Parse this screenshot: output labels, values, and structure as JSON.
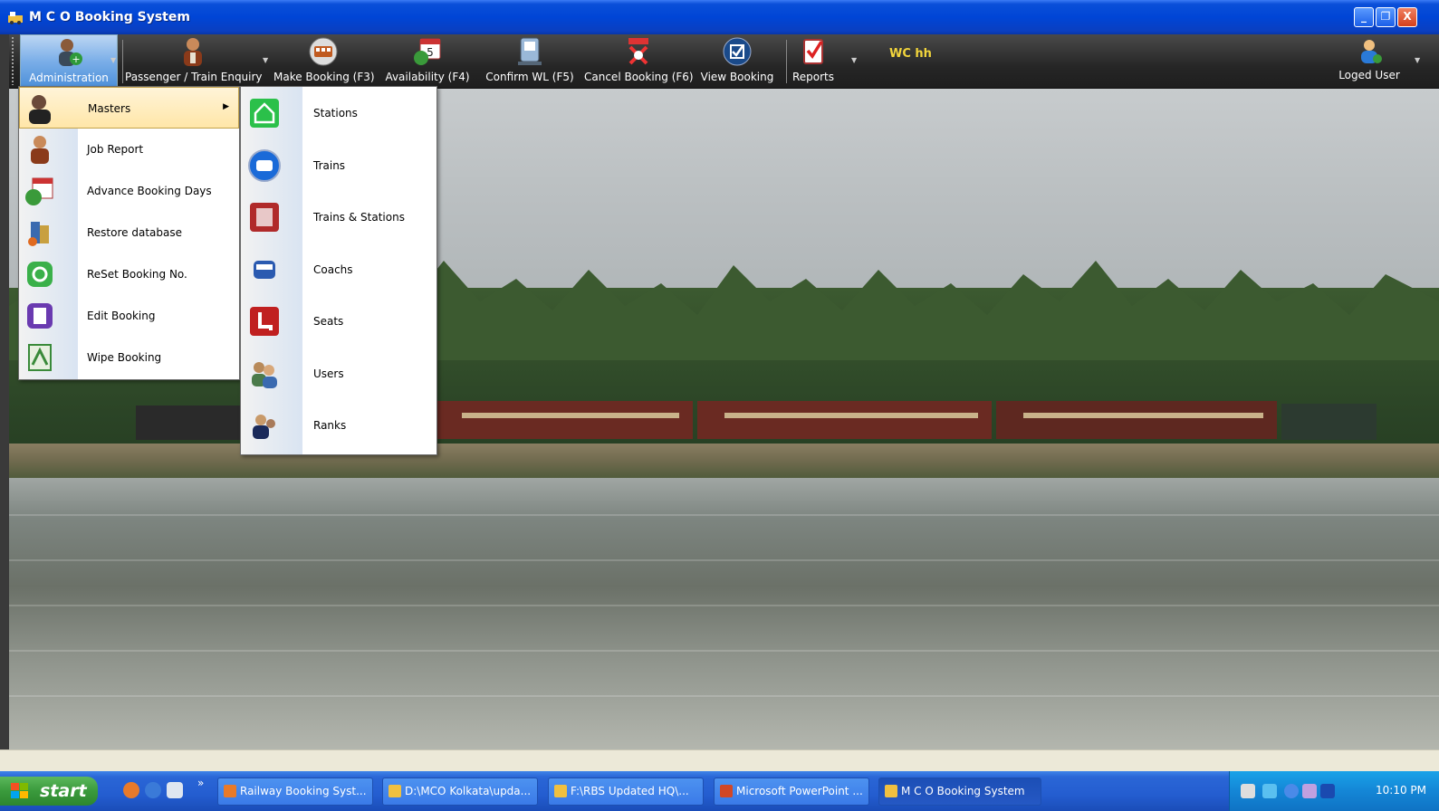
{
  "window": {
    "title": "M C O Booking System",
    "controls": [
      "_",
      "❐",
      "X"
    ]
  },
  "toolbar": {
    "items": [
      {
        "label": "Administration",
        "icon": "admin-user-icon"
      },
      {
        "label": "Passenger / Train Enquiry",
        "icon": "passenger-icon"
      },
      {
        "label": "Make Booking  (F3)",
        "icon": "make-booking-icon"
      },
      {
        "label": "Availability (F4)",
        "icon": "calendar-icon"
      },
      {
        "label": "Confirm WL (F5)",
        "icon": "confirm-wl-icon"
      },
      {
        "label": "Cancel Booking (F6)",
        "icon": "cancel-booking-icon"
      },
      {
        "label": "View Booking",
        "icon": "view-booking-icon"
      },
      {
        "label": "Reports",
        "icon": "reports-icon"
      }
    ],
    "wc_text": "WC hh",
    "user_label": "Loged User"
  },
  "admin_menu": {
    "items": [
      {
        "label": "Masters",
        "icon": "masters-icon",
        "has_submenu": true
      },
      {
        "label": "Job Report",
        "icon": "job-report-icon"
      },
      {
        "label": "Advance Booking Days",
        "icon": "advance-days-icon"
      },
      {
        "label": "Restore database",
        "icon": "restore-db-icon"
      },
      {
        "label": "ReSet Booking No.",
        "icon": "reset-icon"
      },
      {
        "label": "Edit Booking",
        "icon": "edit-booking-icon"
      },
      {
        "label": "Wipe Booking",
        "icon": "wipe-booking-icon"
      }
    ]
  },
  "masters_menu": {
    "items": [
      {
        "label": "Stations",
        "icon": "station-icon"
      },
      {
        "label": "Trains",
        "icon": "train-icon"
      },
      {
        "label": "Trains & Stations",
        "icon": "trains-stations-icon"
      },
      {
        "label": "Coachs",
        "icon": "coach-icon"
      },
      {
        "label": "Seats",
        "icon": "seat-icon"
      },
      {
        "label": "Users",
        "icon": "users-icon"
      },
      {
        "label": "Ranks",
        "icon": "ranks-icon"
      }
    ]
  },
  "taskbar": {
    "start_label": "start",
    "tasks": [
      "Railway Booking Syst...",
      "D:\\MCO Kolkata\\upda...",
      "F:\\RBS Updated HQ\\...",
      "Microsoft PowerPoint ...",
      "M C O Booking System"
    ],
    "overflow": "»",
    "clock": "10:10 PM"
  },
  "colors": {
    "titlebar": "#0045d6",
    "toolbar": "#262626",
    "wc_text": "#f2d53c",
    "taskbar": "#245dd0",
    "start": "#3a9a3c",
    "menu_highlight": "#ffe6a8"
  }
}
